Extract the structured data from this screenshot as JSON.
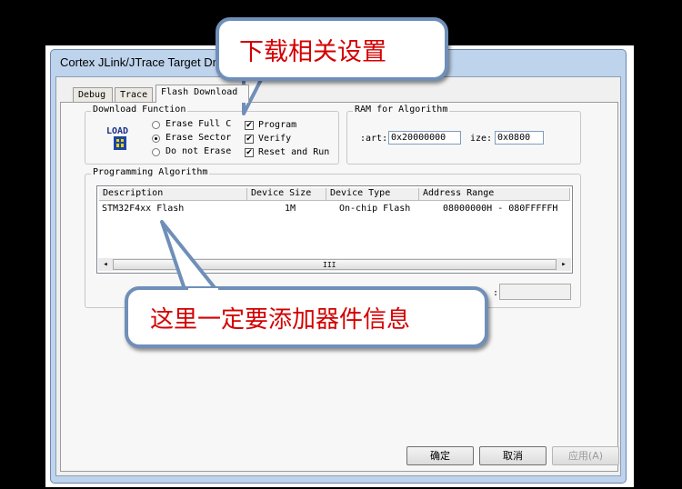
{
  "window": {
    "title": "Cortex JLink/JTrace Target Dri"
  },
  "tabs": [
    {
      "label": "Debug"
    },
    {
      "label": "Trace"
    },
    {
      "label": "Flash Download"
    }
  ],
  "download_function": {
    "legend": "Download Function",
    "load_icon_label": "LOAD",
    "radios": [
      {
        "label": "Erase Full C",
        "selected": false
      },
      {
        "label": "Erase Sector",
        "selected": true
      },
      {
        "label": "Do not Erase",
        "selected": false
      }
    ],
    "checks": [
      {
        "label": "Program",
        "checked": true,
        "mark": "✔"
      },
      {
        "label": "Verify",
        "checked": true,
        "mark": "✔"
      },
      {
        "label": "Reset and Run",
        "checked": true,
        "mark": "✔"
      }
    ]
  },
  "ram": {
    "legend": "RAM for Algorithm",
    "start_label": ":art:",
    "start_value": "0x20000000",
    "size_label": "ize:",
    "size_value": "0x0800"
  },
  "programming_algorithm": {
    "legend": "Programming Algorithm",
    "columns": [
      "Description",
      "Device Size",
      "Device Type",
      "Address Range"
    ],
    "rows": [
      {
        "description": "STM32F4xx Flash",
        "size": "1M",
        "type": "On-chip Flash",
        "range": "08000000H - 080FFFFFH"
      }
    ],
    "scroll_left": "◂",
    "scroll_right": "▸",
    "scroll_grip": "III",
    "partial_label": ":"
  },
  "buttons": {
    "ok": "确定",
    "cancel": "取消",
    "apply": "应用(A)"
  },
  "annotations": {
    "top": "下载相关设置",
    "bottom": "这里一定要添加器件信息"
  },
  "colors": {
    "annotation_text": "#d40000",
    "callout_border": "#6f8fb9",
    "window_frame": "#bed3ec"
  }
}
